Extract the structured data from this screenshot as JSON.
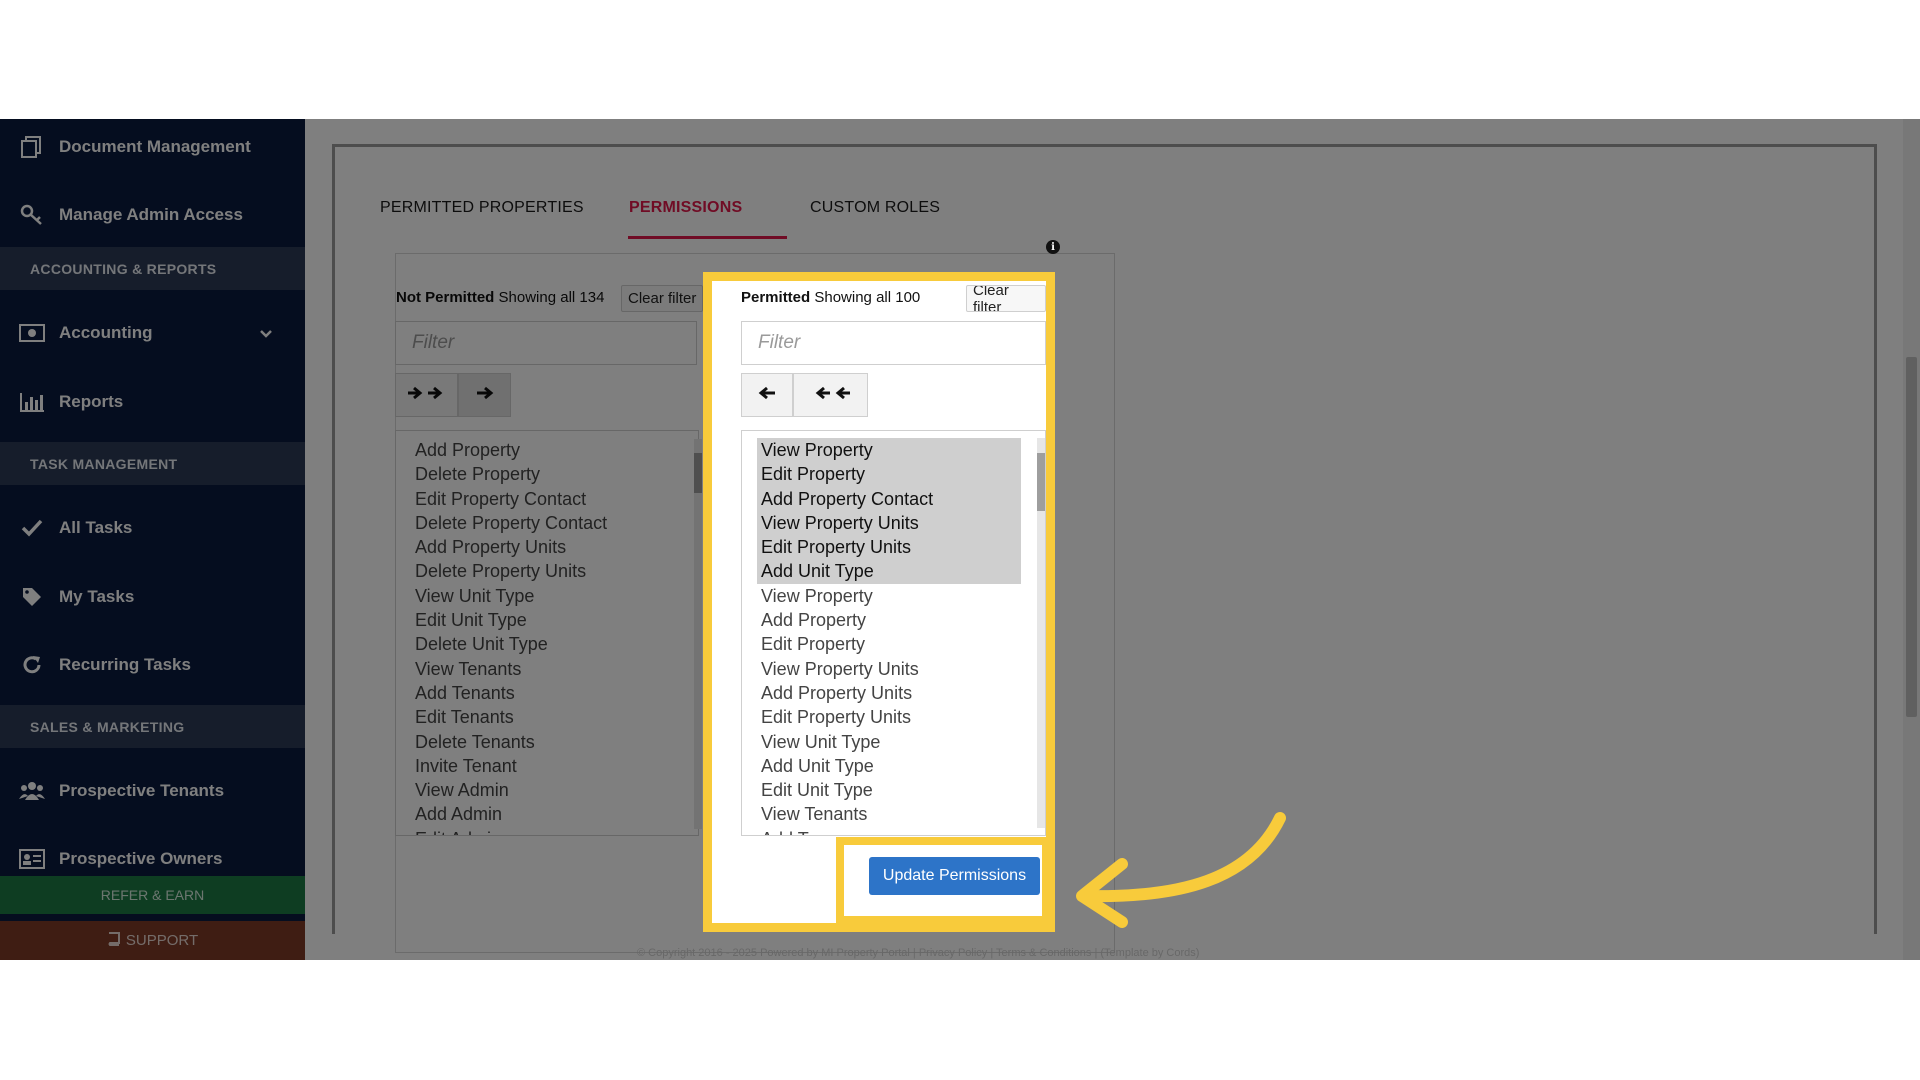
{
  "sidebar": {
    "items_top": [
      {
        "label": "Document Management",
        "icon": "document-icon"
      },
      {
        "label": "Manage Admin Access",
        "icon": "key-icon"
      }
    ],
    "sections": [
      {
        "title": "ACCOUNTING & REPORTS"
      },
      {
        "title": "TASK MANAGEMENT"
      },
      {
        "title": "SALES & MARKETING"
      }
    ],
    "accounting": {
      "label": "Accounting",
      "icon": "money-icon"
    },
    "reports": {
      "label": "Reports",
      "icon": "bar-chart-icon"
    },
    "all_tasks": {
      "label": "All Tasks",
      "icon": "check-icon"
    },
    "my_tasks": {
      "label": "My Tasks",
      "icon": "tag-icon"
    },
    "recurring_tasks": {
      "label": "Recurring Tasks",
      "icon": "refresh-icon"
    },
    "prospective_tenants": {
      "label": "Prospective Tenants",
      "icon": "users-icon"
    },
    "prospective_owners": {
      "label": "Prospective Owners",
      "icon": "id-card-icon"
    },
    "refer_label": "REFER & EARN",
    "support_label": "SUPPORT"
  },
  "tabs": [
    {
      "label": "PERMITTED PROPERTIES"
    },
    {
      "label": "PERMISSIONS"
    },
    {
      "label": "CUSTOM ROLES"
    }
  ],
  "not_permitted": {
    "title": "Not Permitted",
    "count_text": "Showing all 134",
    "clear_label": "Clear filter",
    "filter_placeholder": "Filter",
    "items": [
      "Add Property",
      "Delete Property",
      "Edit Property Contact",
      "Delete Property Contact",
      "Add Property Units",
      "Delete Property Units",
      "View Unit Type",
      "Edit Unit Type",
      "Delete Unit Type",
      "View Tenants",
      "Add Tenants",
      "Edit Tenants",
      "Delete Tenants",
      "Invite Tenant",
      "View Admin",
      "Add Admin",
      "Edit Admin"
    ]
  },
  "permitted": {
    "title": "Permitted",
    "count_text": "Showing all 100",
    "clear_label": "Clear filter",
    "filter_placeholder": "Filter",
    "items_selected": [
      "View Property",
      "Edit Property",
      "Add Property Contact",
      "View Property Units",
      "Edit Property Units",
      "Add Unit Type"
    ],
    "items": [
      "View Property",
      "Add Property",
      "Edit Property",
      "View Property Units",
      "Add Property Units",
      "Edit Property Units",
      "View Unit Type",
      "Add Unit Type",
      "Edit Unit Type",
      "View Tenants",
      "Add T"
    ]
  },
  "update_label": "Update Permissions",
  "footer_text": "© Copyright 2016 - 2025 Powered by MI Property Portal | Privacy Policy | Terms & Conditions | (Template by Cords)",
  "colors": {
    "highlight": "#f8cb3b",
    "sidebar": "#0b1a3f",
    "accent": "#e0194a",
    "button": "#2d74c8"
  }
}
